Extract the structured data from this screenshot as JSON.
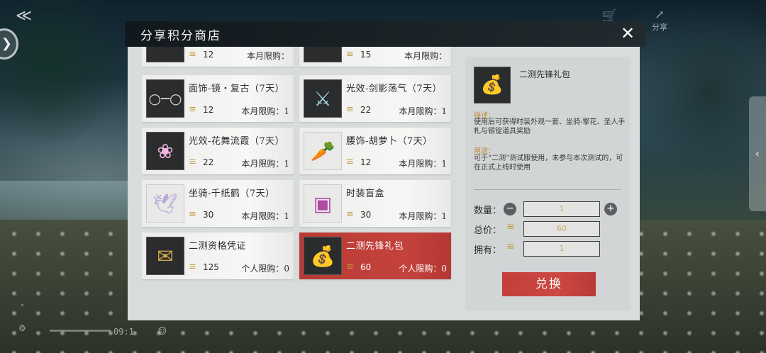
{
  "window": {
    "title": "分享积分商店"
  },
  "hud": {
    "time": "09:1",
    "share_label": "分享"
  },
  "items": [
    {
      "name": "",
      "price": "12",
      "limit": "本月限购：",
      "icon": "partial-item-icon",
      "partial": true
    },
    {
      "name": "",
      "price": "15",
      "limit": "本月限购：",
      "icon": "partial-item-icon",
      "partial": true
    },
    {
      "name": "面饰-镜・复古（7天）",
      "price": "12",
      "limit": "本月限购：1",
      "icon": "glasses-icon"
    },
    {
      "name": "光效-剑影荡气（7天）",
      "price": "22",
      "limit": "本月限购：1",
      "icon": "sword-icon"
    },
    {
      "name": "光效-花舞流霞（7天）",
      "price": "22",
      "limit": "本月限购：1",
      "icon": "flower-effect-icon"
    },
    {
      "name": "腰饰-胡萝卜（7天）",
      "price": "12",
      "limit": "本月限购：1",
      "icon": "carrot-icon"
    },
    {
      "name": "坐骑-千纸鹤（7天）",
      "price": "30",
      "limit": "本月限购：1",
      "icon": "paper-crane-icon"
    },
    {
      "name": "时装盲盒",
      "price": "30",
      "limit": "本月限购：1",
      "icon": "mystery-box-icon"
    },
    {
      "name": "二测资格凭证",
      "price": "125",
      "limit": "个人限购：0",
      "icon": "certificate-icon"
    },
    {
      "name": "二测先锋礼包",
      "price": "60",
      "limit": "个人限购：0",
      "icon": "gift-bag-icon",
      "selected": true
    }
  ],
  "detail": {
    "name": "二测先锋礼包",
    "desc_label": "描述：",
    "desc_text": "使用后可获得时装外观一套、坐骑-擎花、圣人手札与银锭道具奖励",
    "use_label": "用途：",
    "use_text": "可于“二测”测试服使用，未参与本次测试的，可在正式上线时使用",
    "quantity_label": "数量：",
    "quantity": "1",
    "total_label": "总价：",
    "total": "60",
    "owned_label": "拥有：",
    "owned": "1",
    "redeem_label": "兑换"
  },
  "colors": {
    "selected": "#c4423c",
    "accent_gold": "#c39a45",
    "header": "#1c2327"
  }
}
